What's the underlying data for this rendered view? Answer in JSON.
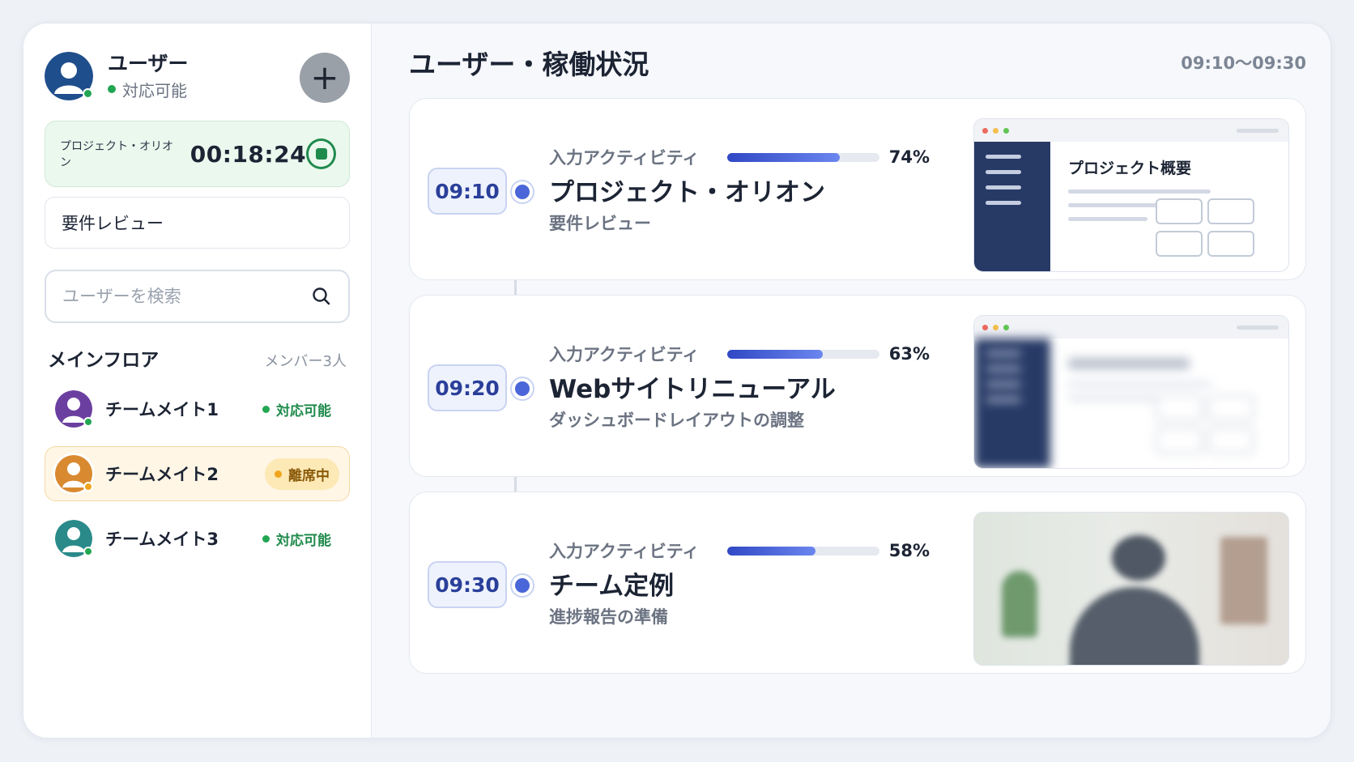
{
  "user": {
    "name": "ユーザー",
    "status": "対応可能",
    "status_color": "#22a652",
    "avatar_color": "#1f4e8c"
  },
  "add_button_label": "+",
  "timer": {
    "project": "プロジェクト・オリオン",
    "elapsed": "00:18:24",
    "stop_icon": "stop-icon"
  },
  "task": {
    "value": "要件レビュー"
  },
  "search": {
    "placeholder": "ユーザーを検索",
    "value": ""
  },
  "floor": {
    "title": "メインフロア",
    "count": "メンバー3人",
    "members": [
      {
        "name": "チームメイト1",
        "status": "対応可能",
        "avatar_color": "#6b3fa0",
        "presence_color": "#22a652",
        "status_kind": "ok"
      },
      {
        "name": "チームメイト2",
        "status": "離席中",
        "avatar_color": "#d9892f",
        "presence_color": "#f0a51c",
        "status_kind": "away"
      },
      {
        "name": "チームメイト3",
        "status": "対応可能",
        "avatar_color": "#2a8a8a",
        "presence_color": "#22a652",
        "status_kind": "ok"
      }
    ]
  },
  "main": {
    "title": "ユーザー・稼働状況",
    "range": "09:10〜09:30",
    "activity_label": "入力アクティビティ",
    "entries": [
      {
        "time": "09:10",
        "activity": 74,
        "activity_text": "74%",
        "title": "プロジェクト・オリオン",
        "subtitle": "要件レビュー",
        "thumb_title": "プロジェクト概要",
        "thumb_type": "window"
      },
      {
        "time": "09:20",
        "activity": 63,
        "activity_text": "63%",
        "title": "Webサイトリニューアル",
        "subtitle": "ダッシュボードレイアウトの調整",
        "thumb_type": "window-blurred"
      },
      {
        "time": "09:30",
        "activity": 58,
        "activity_text": "58%",
        "title": "チーム定例",
        "subtitle": "進捗報告の準備",
        "thumb_type": "camera-blurred"
      }
    ]
  },
  "colors": {
    "accent": "#4a66d8",
    "ok_green": "#1f8a4c",
    "away_amber": "#f0a51c"
  }
}
